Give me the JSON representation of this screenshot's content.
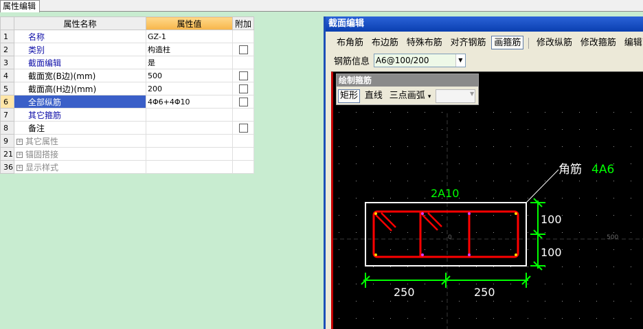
{
  "tab": {
    "label": "属性编辑"
  },
  "grid": {
    "header_name": "属性名称",
    "header_value": "属性值",
    "header_attach": "附加",
    "rows": [
      {
        "idx": "1",
        "name": "名称",
        "value": "GZ-1",
        "check": false,
        "style": "blue"
      },
      {
        "idx": "2",
        "name": "类别",
        "value": "构造柱",
        "check": true,
        "style": "blue"
      },
      {
        "idx": "3",
        "name": "截面编辑",
        "value": "是",
        "check": false,
        "style": "blue"
      },
      {
        "idx": "4",
        "name": "截面宽(B边)(mm)",
        "value": "500",
        "check": true,
        "style": "plain"
      },
      {
        "idx": "5",
        "name": "截面高(H边)(mm)",
        "value": "200",
        "check": true,
        "style": "plain"
      },
      {
        "idx": "6",
        "name": "全部纵筋",
        "value": "4Φ6+4Φ10",
        "check": true,
        "style": "selected"
      },
      {
        "idx": "7",
        "name": "其它箍筋",
        "value": "",
        "check": false,
        "style": "blue"
      },
      {
        "idx": "8",
        "name": "备注",
        "value": "",
        "check": true,
        "style": "plain"
      },
      {
        "idx": "9",
        "name": "其它属性",
        "value": "",
        "check": false,
        "style": "group"
      },
      {
        "idx": "21",
        "name": "锚固搭接",
        "value": "",
        "check": false,
        "style": "group"
      },
      {
        "idx": "36",
        "name": "显示样式",
        "value": "",
        "check": false,
        "style": "group"
      }
    ]
  },
  "section_editor": {
    "title": "截面编辑",
    "toolbar": [
      {
        "label": "布角筋",
        "active": false
      },
      {
        "label": "布边筋",
        "active": false
      },
      {
        "label": "特殊布筋",
        "active": false
      },
      {
        "label": "对齐钢筋",
        "active": false
      },
      {
        "label": "画箍筋",
        "active": true
      },
      {
        "label": "修改纵筋",
        "active": false
      },
      {
        "label": "修改箍筋",
        "active": false
      },
      {
        "label": "编辑弯钩",
        "active": false
      }
    ],
    "rebar_info_label": "钢筋信息",
    "rebar_info_value": "A6@100/200",
    "palette": {
      "title": "绘制箍筋",
      "buttons": [
        {
          "label": "矩形",
          "active": true
        },
        {
          "label": "直线",
          "active": false
        },
        {
          "label": "三点画弧",
          "active": false
        }
      ],
      "arc_value": ""
    },
    "drawing": {
      "corner_label": "角筋",
      "corner_value": "4A6",
      "top_label": "2A10",
      "dim_right_1": "100",
      "dim_right_2": "100",
      "dim_bottom_1": "250",
      "dim_bottom_2": "250",
      "origin_label": "0",
      "axis_label": "500"
    },
    "colors": {
      "stirrup": "#ff0000",
      "dimension": "#00ff00",
      "outline": "#ffffff",
      "corner_value": "#00ff00"
    }
  }
}
